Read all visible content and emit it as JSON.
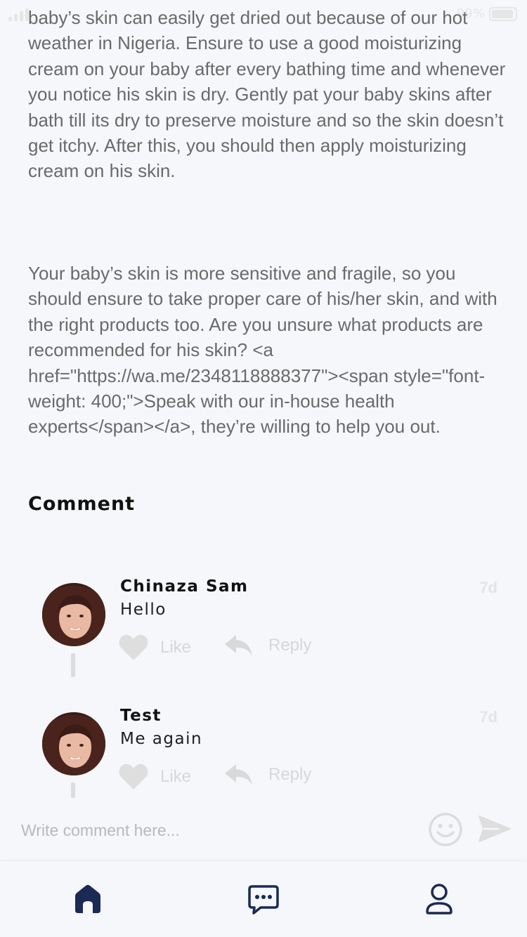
{
  "status_bar": {
    "battery_percent": "99%"
  },
  "article": {
    "paragraphs": [
      "baby’s skin can easily get dried out because of our hot weather in Nigeria. Ensure to use a good moisturizing cream on your baby after every bathing time and whenever you notice his skin is dry. Gently pat your baby skins after bath till its dry to preserve moisture and so the skin doesn’t get itchy. After this, you should then apply moisturizing cream on his skin.",
      "Your baby’s skin is more sensitive and fragile, so you should ensure to take proper care of his/her skin, and with the right products too. Are you unsure what products are recommended for his skin? <a href=\"https://wa.me/2348118888377\"><span style=\"font-weight: 400;\">Speak with our in-house health experts</span></a>, they’re willing to help you out."
    ]
  },
  "comments_section": {
    "heading": "Comment",
    "comments": [
      {
        "author": "Chinaza Sam",
        "text": "Hello",
        "time": "7d",
        "like_label": "Like",
        "reply_label": "Reply"
      },
      {
        "author": "Test",
        "text": "Me again",
        "time": "7d",
        "like_label": "Like",
        "reply_label": "Reply"
      }
    ]
  },
  "composer": {
    "placeholder": "Write comment here...",
    "emoji_icon": "smiley-icon",
    "send_icon": "send-icon"
  },
  "bottom_nav": {
    "items": [
      {
        "icon": "home-icon",
        "active": true
      },
      {
        "icon": "chat-icon",
        "active": false
      },
      {
        "icon": "profile-icon",
        "active": false
      }
    ]
  },
  "colors": {
    "background": "#f5f7fa",
    "nav_icon": "#1b2a55",
    "muted_action": "#d7d7d7",
    "body_text": "#6a6a6a"
  }
}
